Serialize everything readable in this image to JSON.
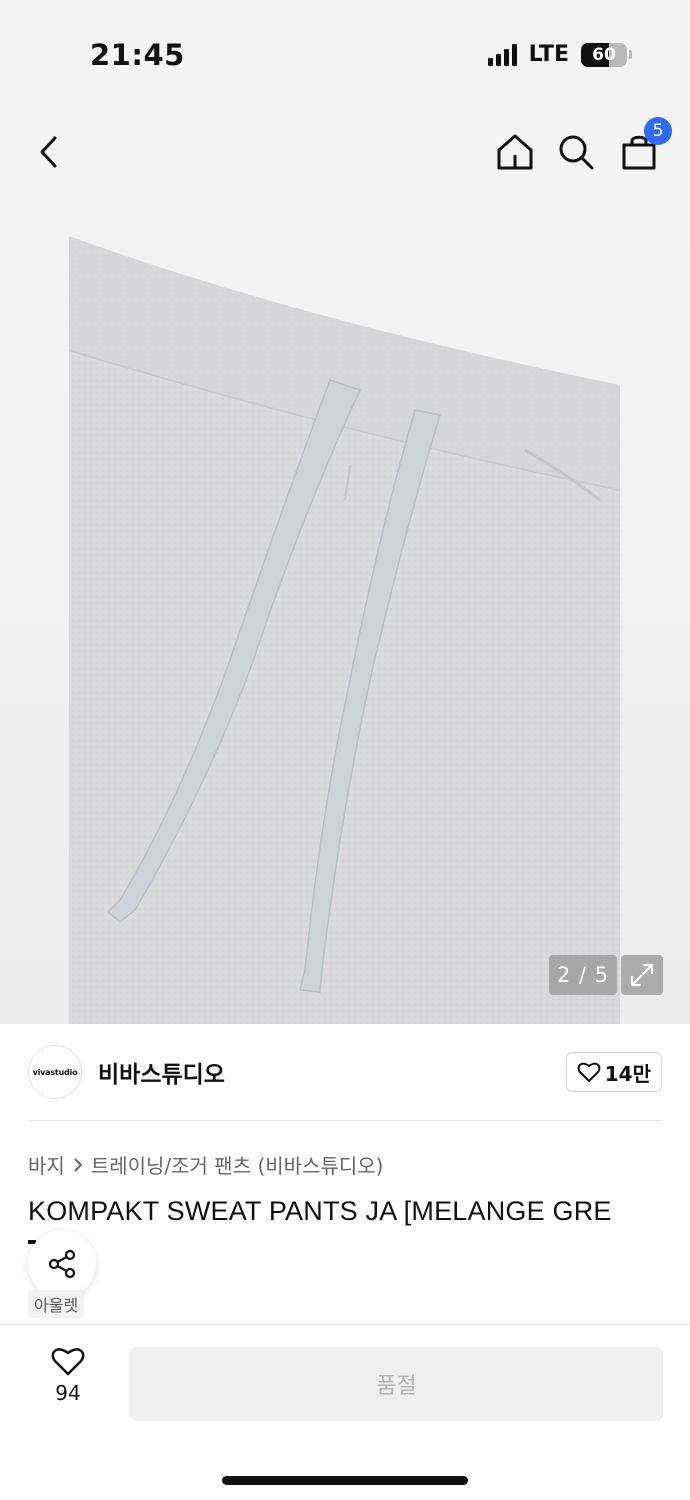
{
  "status": {
    "time": "21:45",
    "network": "LTE",
    "battery": "60"
  },
  "nav": {
    "back_icon": "chevron-left-icon",
    "home_icon": "home-icon",
    "search_icon": "search-icon",
    "cart_icon": "shopping-bag-icon",
    "cart_count": "5"
  },
  "gallery": {
    "counter": "2 / 5",
    "current": 2,
    "total": 5,
    "expand_icon": "expand-icon"
  },
  "brand": {
    "logo_text": "vivastudio",
    "name": "비바스튜디오",
    "likes": "14만"
  },
  "breadcrumb": {
    "category": "바지",
    "subcategory": "트레이닝/조거 팬츠 (비바스튜디오)"
  },
  "product": {
    "title": "KOMPAKT SWEAT PANTS JA [MELANGE GRE",
    "tag": "아울렛"
  },
  "bottom": {
    "wish_count": "94",
    "soldout_label": "품절"
  },
  "colors": {
    "accent": "#2f6bf6",
    "soldout_bg": "#efefef"
  }
}
